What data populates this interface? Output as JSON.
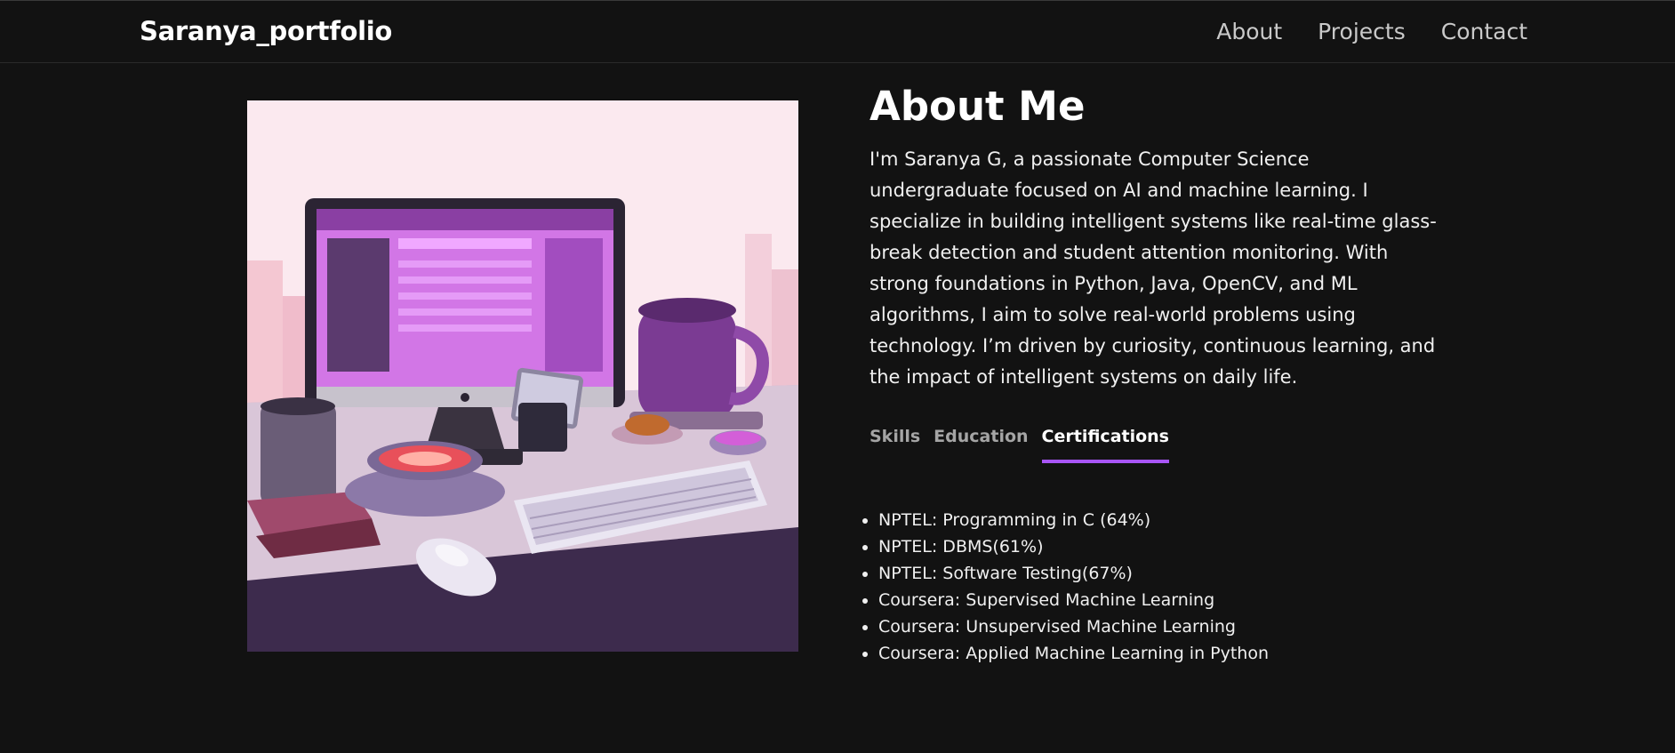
{
  "header": {
    "brand": "Saranya_portfolio",
    "nav": [
      {
        "label": "About"
      },
      {
        "label": "Projects"
      },
      {
        "label": "Contact"
      }
    ]
  },
  "about": {
    "title": "About Me",
    "bio": "I'm Saranya G, a passionate Computer Science undergraduate focused on AI and machine learning. I specialize in building intelligent systems like real-time glass-break detection and student attention monitoring. With strong foundations in Python, Java, OpenCV, and ML algorithms, I aim to solve real-world problems using technology. I’m driven by curiosity, continuous learning, and the impact of intelligent systems on daily life.",
    "tabs": [
      {
        "label": "Skills",
        "active": false
      },
      {
        "label": "Education",
        "active": false
      },
      {
        "label": "Certifications",
        "active": true
      }
    ],
    "certifications": [
      "NPTEL: Programming in C (64%)",
      "NPTEL: DBMS(61%)",
      "NPTEL: Software Testing(67%)",
      "Coursera: Supervised Machine Learning",
      "Coursera: Unsupervised Machine Learning",
      "Coursera: Applied Machine Learning in Python"
    ]
  },
  "colors": {
    "background": "#121212",
    "accent": "#a855f7",
    "text": "#ffffff",
    "muted": "#a5a5a5"
  }
}
